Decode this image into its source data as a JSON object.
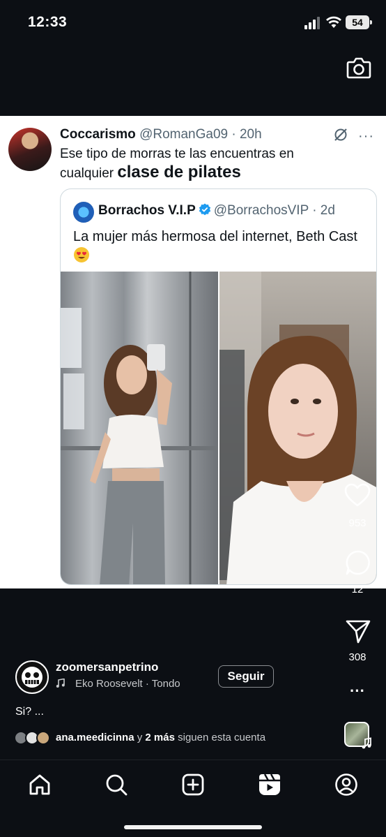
{
  "status_bar": {
    "time": "12:33",
    "battery": "54"
  },
  "tweet": {
    "display_name": "Coccarismo",
    "handle_time": "@RomanGa09 · 20h",
    "text": "Ese tipo de morras te las encuentras en cualquier",
    "text_overlay": "clase de pilates",
    "more": "···"
  },
  "quoted_tweet": {
    "display_name": "Borrachos V.I.P",
    "handle_time": "@BorrachosVIP · 2d",
    "text": "La mujer más hermosa del internet, Beth Cast"
  },
  "actions": {
    "likes": "953",
    "comments": "12",
    "shares": "308",
    "more": "···"
  },
  "account": {
    "username": "zoomersanpetrino",
    "audio": "Eko Roosevelt · Tondo",
    "follow_label": "Seguir",
    "caption": "Si? ...",
    "followed_by_user": "ana.meedicinna",
    "followed_by_joiner": "y",
    "followed_by_more": "2 más",
    "followed_by_suffix": "siguen esta cuenta"
  },
  "nav": [
    "home-icon",
    "search-icon",
    "create-icon",
    "reels-icon",
    "profile-icon"
  ]
}
